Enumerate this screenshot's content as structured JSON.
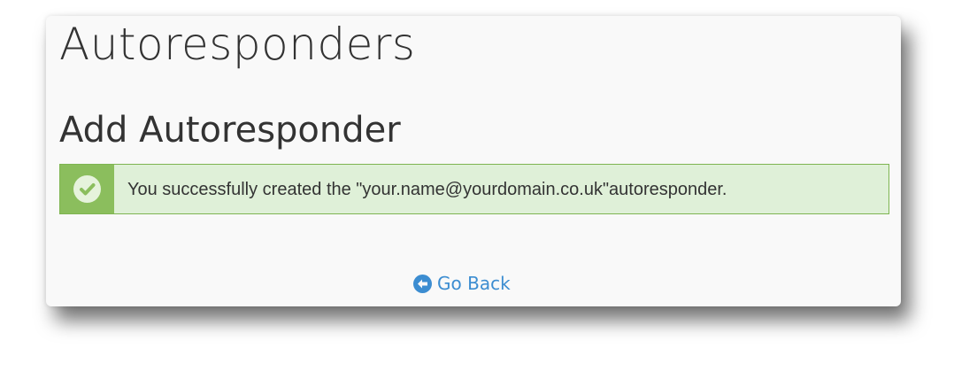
{
  "page": {
    "title": "Autoresponders"
  },
  "section": {
    "title": "Add Autoresponder"
  },
  "alert": {
    "status": "success",
    "icon": "check-circle-icon",
    "message": "You successfully created the \"your.name@yourdomain.co.uk\"autoresponder.",
    "colors": {
      "background": "#dff0d8",
      "border": "#7fb552",
      "icon_bg": "#8bbe5d"
    }
  },
  "nav": {
    "go_back_label": "Go Back",
    "go_back_icon": "arrow-left-circle-icon",
    "link_color": "#3c8dd1"
  }
}
